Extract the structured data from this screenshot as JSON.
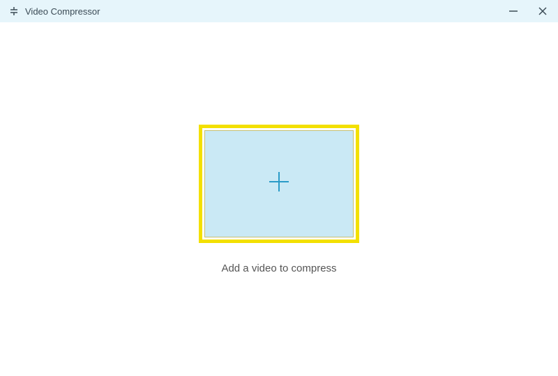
{
  "window": {
    "title": "Video Compressor"
  },
  "main": {
    "prompt_text": "Add a video to compress"
  }
}
